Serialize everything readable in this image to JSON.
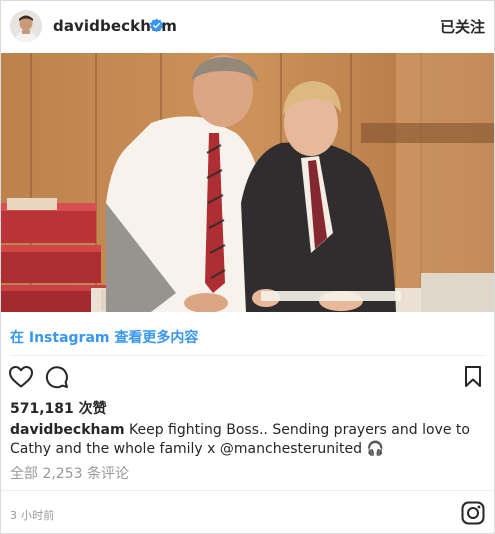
{
  "header": {
    "username": "davidbeckham",
    "follow_label": "已关注",
    "verified_color": "#3897f0"
  },
  "post": {
    "view_more_label": "在 Instagram 查看更多内容",
    "likes_count": "571,181",
    "likes_suffix": "次赞",
    "caption_user": "davidbeckham",
    "caption_text": "Keep fighting Boss.. Sending prayers and love to Cathy and the whole family x",
    "caption_mention": "@manchesterunited",
    "caption_emoji": "🎧",
    "comments_label": "全部 2,253 条评论",
    "time_label": "3 小时前"
  },
  "icons": {
    "like": "heart-icon",
    "comment": "comment-icon",
    "save": "bookmark-icon",
    "brand": "instagram-icon"
  },
  "colors": {
    "link": "#3897f0",
    "muted": "#999999",
    "text": "#262626"
  }
}
